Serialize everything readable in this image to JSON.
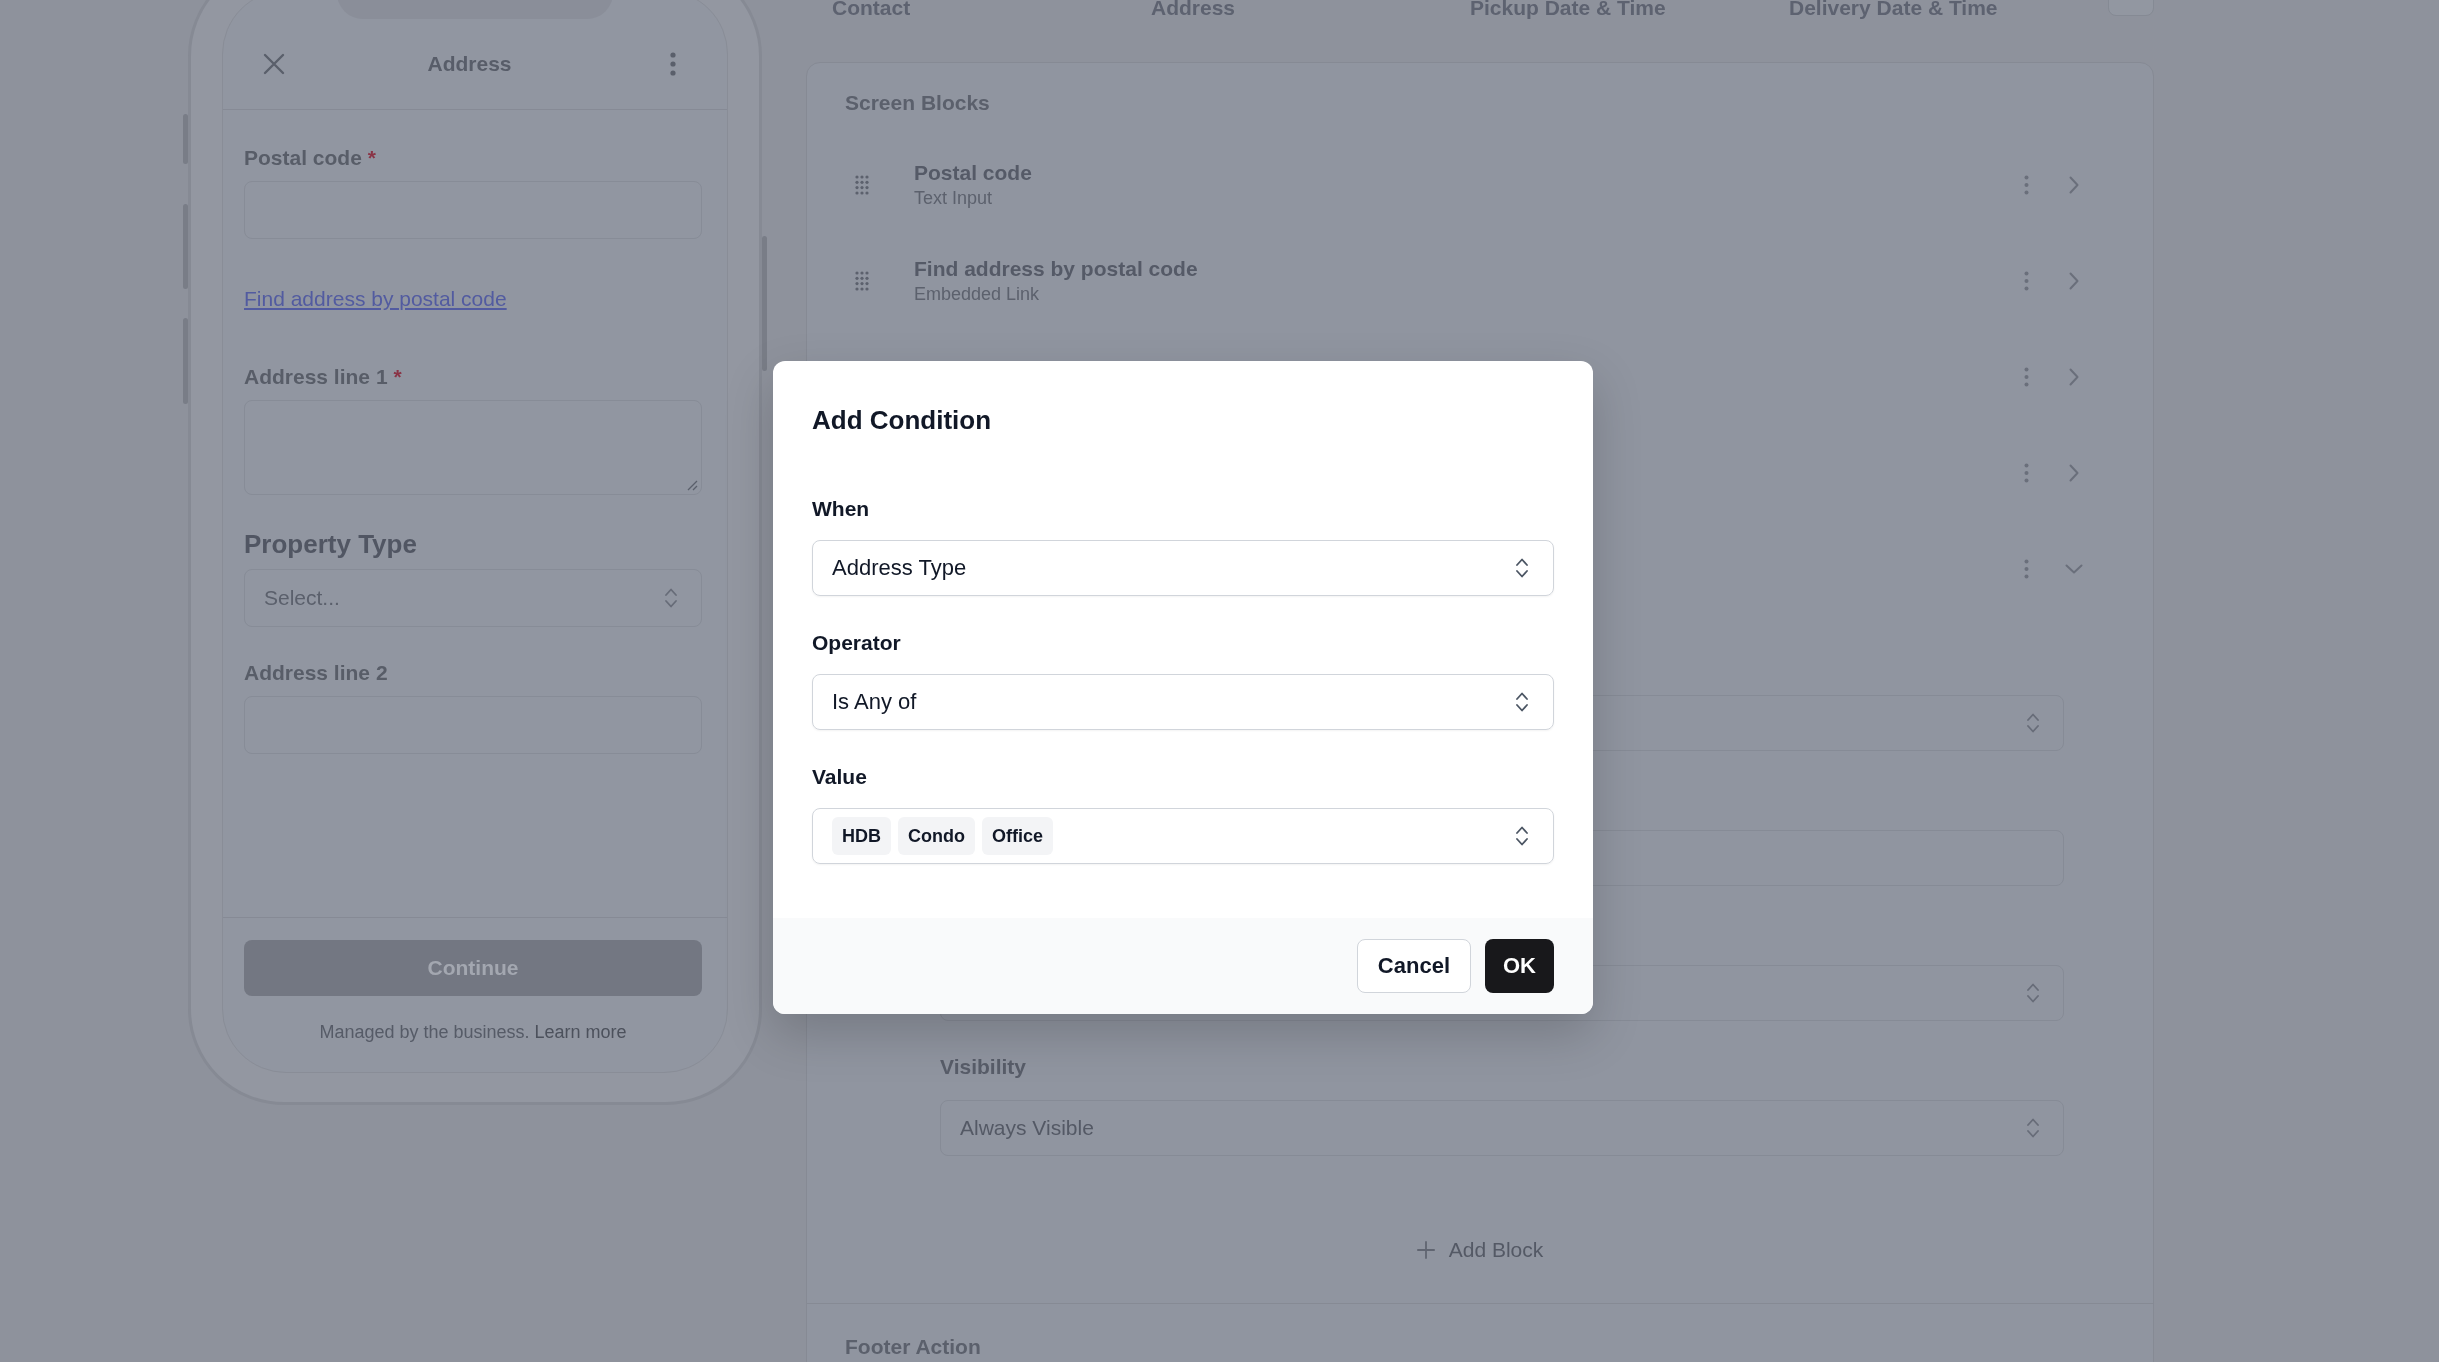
{
  "phone_preview": {
    "title": "Address",
    "fields": [
      {
        "kind": "input",
        "label": "Postal code",
        "required_mark": "*"
      },
      {
        "kind": "link",
        "label": "Find address by postal code"
      },
      {
        "kind": "textarea",
        "label": "Address line 1",
        "required_mark": "*"
      },
      {
        "kind": "select",
        "label": "Property Type",
        "placeholder": "Select..."
      },
      {
        "kind": "input",
        "label": "Address line 2"
      }
    ],
    "button": {
      "label": "Continue",
      "disabled": true
    },
    "note": {
      "text": "Managed by the business.",
      "link": "Learn more"
    }
  },
  "steps": [
    "Contact",
    "Address",
    "Pickup Date & Time",
    "Delivery Date & Time"
  ],
  "editor": {
    "title": "Screen Blocks",
    "blocks": [
      {
        "title": "Postal code",
        "type": "Text Input",
        "expanded": false
      },
      {
        "title": "Find address by postal code",
        "type": "Embedded Link",
        "expanded": false
      },
      {
        "expanded": false
      },
      {
        "expanded": false
      },
      {
        "expanded": true,
        "settings": [
          {
            "kind": "select"
          },
          {
            "kind": "input"
          },
          {
            "kind": "select"
          },
          {
            "kind": "select",
            "label": "Visibility",
            "value": "Always Visible"
          }
        ]
      }
    ],
    "add_button": "Add Block",
    "footer_title": "Footer Action"
  },
  "dialog": {
    "title": "Add Condition",
    "fields": [
      {
        "label": "When",
        "value": "Address Type"
      },
      {
        "label": "Operator",
        "value": "Is Any of"
      },
      {
        "label": "Value",
        "chips": [
          "HDB",
          "Condo",
          "Office"
        ]
      }
    ],
    "buttons": [
      {
        "label": "Cancel",
        "kind": "secondary"
      },
      {
        "label": "OK",
        "kind": "primary"
      }
    ]
  }
}
